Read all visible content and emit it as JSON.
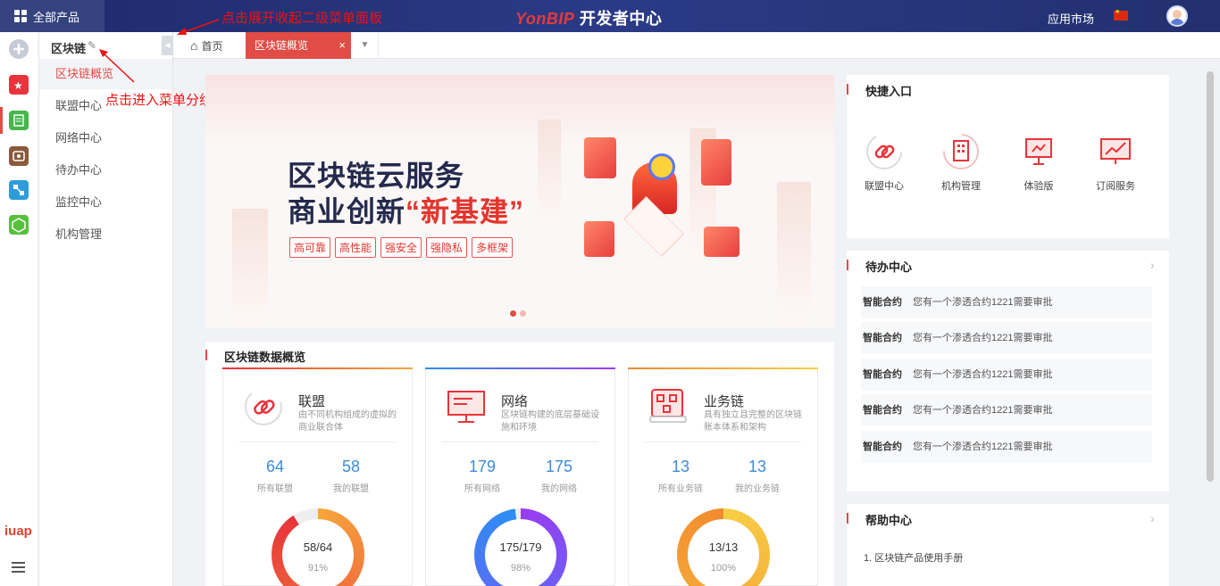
{
  "topbar": {
    "all_products": "全部产品",
    "brand_yon": "YonBIP",
    "brand_rest": " 开发者中心",
    "app_market": "应用市场"
  },
  "sidebar": {
    "title": "区块链",
    "items": [
      {
        "label": "区块链概览"
      },
      {
        "label": "联盟中心"
      },
      {
        "label": "网络中心"
      },
      {
        "label": "待办中心"
      },
      {
        "label": "监控中心"
      },
      {
        "label": "机构管理"
      }
    ]
  },
  "tabs": {
    "home": "首页",
    "active": "区块链概览",
    "close": "×",
    "more": "▼"
  },
  "annotations": {
    "expand": "点击展开收起二级菜单面板",
    "edit": "点击进入菜单分组编辑"
  },
  "banner": {
    "line1": "区块链云服务",
    "line2_a": "商业创新",
    "line2_b": "“新基建”",
    "tags": [
      "高可靠",
      "高性能",
      "强安全",
      "强隐私",
      "多框架"
    ]
  },
  "quick": {
    "title": "快捷入口",
    "items": [
      {
        "label": "联盟中心",
        "icon": "link-icon"
      },
      {
        "label": "机构管理",
        "icon": "building-icon"
      },
      {
        "label": "体验版",
        "icon": "presentation-icon"
      },
      {
        "label": "订阅服务",
        "icon": "chart-board-icon"
      }
    ]
  },
  "todo": {
    "title": "待办中心",
    "rows": [
      {
        "key": "智能合约",
        "text": "您有一个渗透合约1221需要审批"
      },
      {
        "key": "智能合约",
        "text": "您有一个渗透合约1221需要审批"
      },
      {
        "key": "智能合约",
        "text": "您有一个渗透合约1221需要审批"
      },
      {
        "key": "智能合约",
        "text": "您有一个渗透合约1221需要审批"
      },
      {
        "key": "智能合约",
        "text": "您有一个渗透合约1221需要审批"
      }
    ]
  },
  "help": {
    "title": "帮助中心",
    "items": [
      "1. 区块链产品使用手册"
    ]
  },
  "overview": {
    "title": "区块链数据概览",
    "cards": [
      {
        "name": "联盟",
        "desc": "由不同机构组成的虚拟的商业联合体",
        "a_num": "64",
        "a_label": "所有联盟",
        "b_num": "58",
        "b_label": "我的联盟",
        "ring_value": "58/64",
        "ring_pct": "91%",
        "fraction": 0.91,
        "color_from": "#f7a63c",
        "color_to": "#e8323a"
      },
      {
        "name": "网络",
        "desc": "区块链构建的底层基础设施和环境",
        "a_num": "179",
        "a_label": "所有网络",
        "b_num": "175",
        "b_label": "我的网络",
        "ring_value": "175/179",
        "ring_pct": "98%",
        "fraction": 0.98,
        "color_from": "#9b3cf2",
        "color_to": "#2b8ff5"
      },
      {
        "name": "业务链",
        "desc": "具有独立且完整的区块链账本体系和架构",
        "a_num": "13",
        "a_label": "所有业务链",
        "b_num": "13",
        "b_label": "我的业务链",
        "ring_value": "13/13",
        "ring_pct": "100%",
        "fraction": 1.0,
        "color_from": "#f7cf45",
        "color_to": "#f28a2e"
      }
    ]
  },
  "colors": {
    "accent": "#e14c46",
    "topbar": "#25306f",
    "link_blue": "#3d8bd9"
  }
}
